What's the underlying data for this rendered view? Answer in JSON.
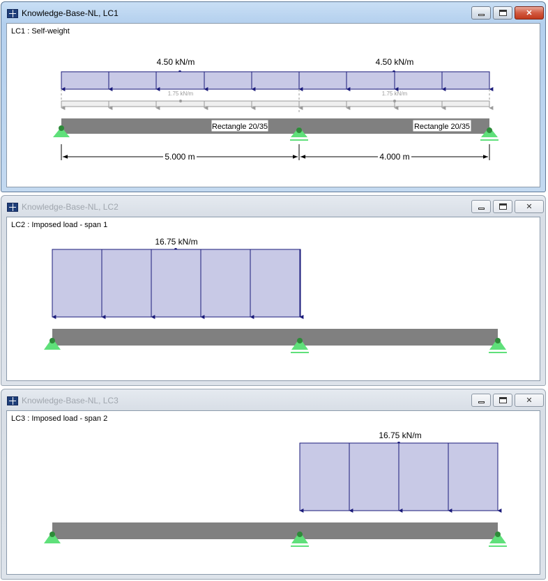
{
  "windows": [
    {
      "title": "Knowledge-Base-NL, LC1",
      "lc_label": "LC1 : Self-weight",
      "active": true,
      "loads": {
        "span1_label": "4.50 kN/m",
        "span2_label": "4.50 kN/m",
        "span1_sw_label": "1.75 kN/m",
        "span2_sw_label": "1.75 kN/m"
      },
      "sections": {
        "span1": "Rectangle 20/35",
        "span2": "Rectangle 20/35"
      },
      "dimensions": {
        "span1": "5.000 m",
        "span2": "4.000 m"
      }
    },
    {
      "title": "Knowledge-Base-NL, LC2",
      "lc_label": "LC2 : Imposed load - span 1",
      "active": false,
      "loads": {
        "label": "16.75 kN/m"
      }
    },
    {
      "title": "Knowledge-Base-NL, LC3",
      "lc_label": "LC3 : Imposed load - span 2",
      "active": false,
      "loads": {
        "label": "16.75 kN/m"
      }
    }
  ],
  "colors": {
    "load_fill": "#c8c9e6",
    "load_line": "#1a1a7a",
    "selfweight_line": "#9a9a9a",
    "beam": "#808080",
    "support": "#5fe07a",
    "hinge": "#2e8b3a"
  },
  "icons": {
    "app": "rfem-app-icon",
    "minimize": "minimize-icon",
    "maximize": "maximize-icon",
    "close": "close-icon"
  }
}
